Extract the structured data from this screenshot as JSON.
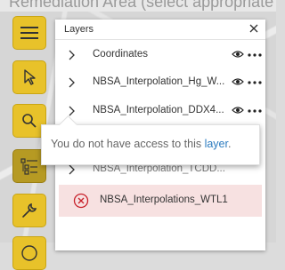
{
  "topbar": {
    "text": "Remediation Area (select appropriate"
  },
  "toolbar": {
    "buttons": [
      {
        "icon": "hamburger-menu-icon"
      },
      {
        "icon": "select-pointer-icon"
      },
      {
        "icon": "search-icon"
      },
      {
        "icon": "layer-list-icon",
        "active": true
      },
      {
        "icon": "wrench-icon"
      },
      {
        "icon": "info-icon"
      }
    ]
  },
  "layers_panel": {
    "title": "Layers",
    "items": [
      {
        "label": "Coordinates"
      },
      {
        "label": "NBSA_Interpolation_Hg_W..."
      },
      {
        "label": "NBSA_Interpolation_DDX4..."
      },
      {
        "label": "NBSA_Interpolation_TCDD..."
      },
      {
        "label": "NBSA_Interpolations_WTL1",
        "error": true
      }
    ]
  },
  "tooltip": {
    "text": "You do not have access to this ",
    "link": "layer",
    "suffix": "."
  },
  "colors": {
    "toolbar_button": "#e8c22a",
    "toolbar_button_active": "#b69a23",
    "error_row_bg": "#f7e1e1",
    "error_icon": "#c8202a",
    "link": "#2b7bbf"
  }
}
